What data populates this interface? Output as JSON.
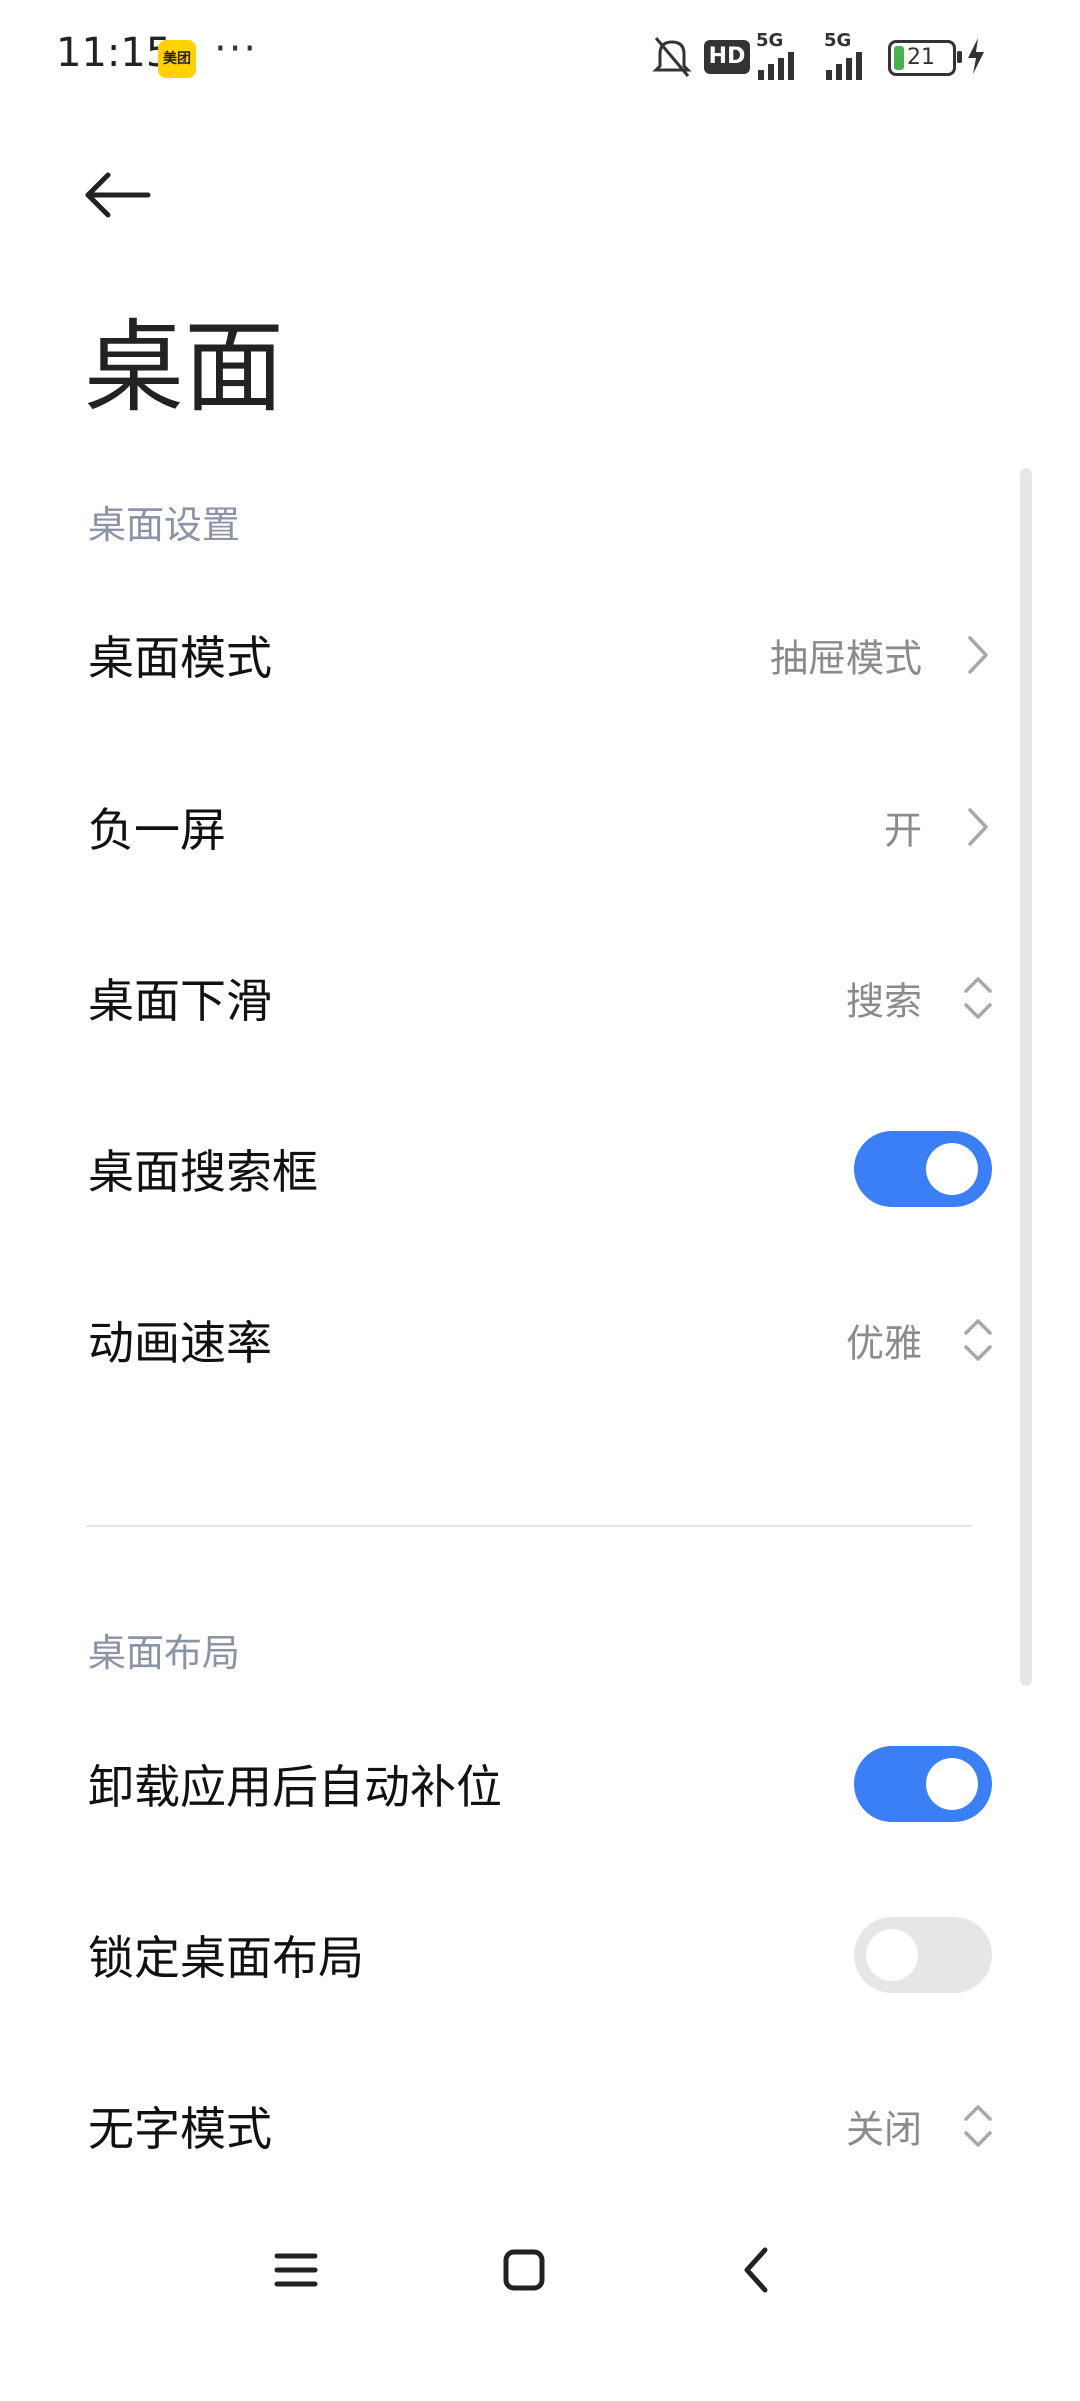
{
  "status_bar": {
    "time": "11:15",
    "app_badge": "美团",
    "more": "···",
    "battery_level": "21",
    "network_1": "5G",
    "network_2": "5G",
    "hd_label": "HD"
  },
  "page": {
    "title": "桌面"
  },
  "sections": {
    "settings_header": "桌面设置",
    "layout_header": "桌面布局"
  },
  "rows": {
    "desktop_mode": {
      "label": "桌面模式",
      "value": "抽屉模式"
    },
    "minus_one_screen": {
      "label": "负一屏",
      "value": "开"
    },
    "desktop_swipe_down": {
      "label": "桌面下滑",
      "value": "搜索"
    },
    "desktop_search_box": {
      "label": "桌面搜索框",
      "enabled": true
    },
    "animation_speed": {
      "label": "动画速率",
      "value": "优雅"
    },
    "auto_fill_after_uninstall": {
      "label": "卸载应用后自动补位",
      "enabled": true
    },
    "lock_layout": {
      "label": "锁定桌面布局",
      "enabled": false
    },
    "no_text_mode": {
      "label": "无字模式",
      "value": "关闭"
    }
  },
  "colors": {
    "accent": "#3a7ff5",
    "section_header": "#8c93a8",
    "value_text": "#8b8b8b",
    "toggle_off": "#e6e6e6"
  }
}
